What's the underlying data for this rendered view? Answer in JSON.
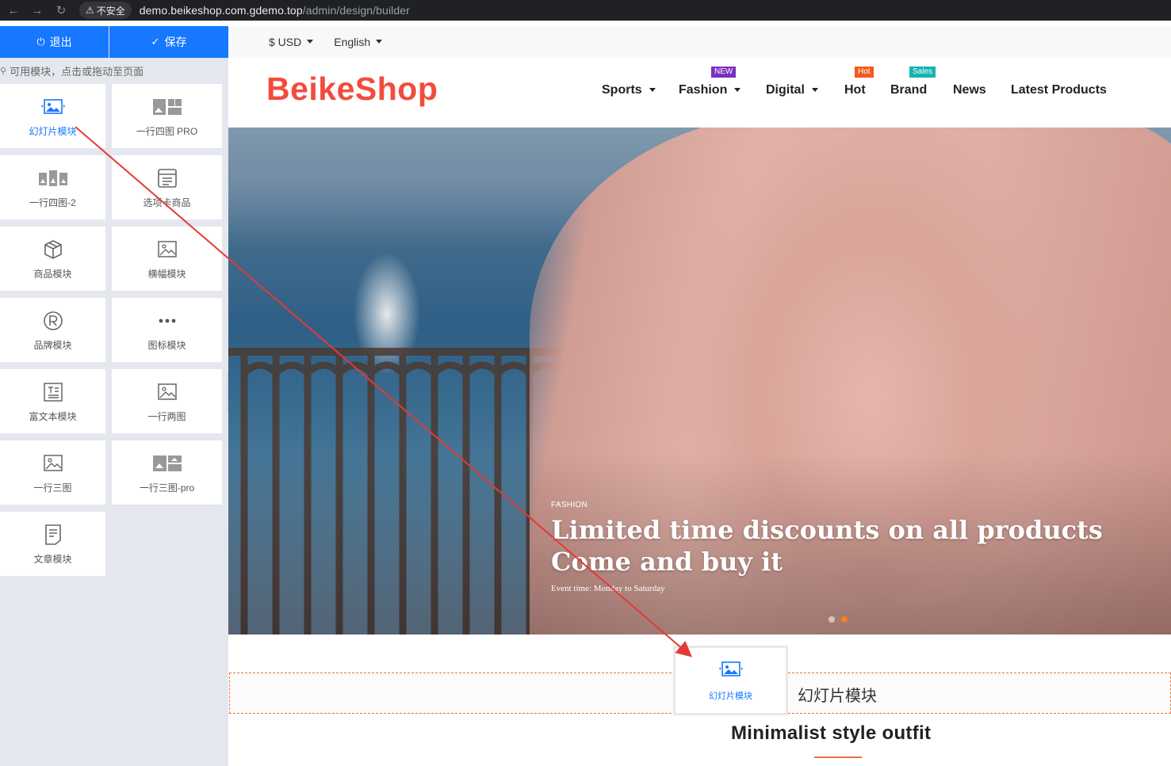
{
  "browser": {
    "security_label": "不安全",
    "url_host": "demo.beikeshop.com.gdemo.top",
    "url_path": "/admin/design/builder"
  },
  "panel": {
    "exit_label": "退出",
    "save_label": "保存",
    "hint": "可用模块，点击或拖动至页面",
    "modules": [
      {
        "label": "幻灯片模块",
        "icon": "image-slide-icon"
      },
      {
        "label": "一行四图 PRO",
        "icon": "four-images-pro-icon"
      },
      {
        "label": "一行四图-2",
        "icon": "four-images-icon"
      },
      {
        "label": "选项卡商品",
        "icon": "tab-products-icon"
      },
      {
        "label": "商品模块",
        "icon": "product-box-icon"
      },
      {
        "label": "横幅模块",
        "icon": "banner-image-icon"
      },
      {
        "label": "品牌模块",
        "icon": "registered-brand-icon"
      },
      {
        "label": "图标模块",
        "icon": "dots-icon"
      },
      {
        "label": "富文本模块",
        "icon": "rich-text-icon"
      },
      {
        "label": "一行两图",
        "icon": "two-images-icon"
      },
      {
        "label": "一行三图",
        "icon": "three-images-icon"
      },
      {
        "label": "一行三图-pro",
        "icon": "three-images-pro-icon"
      },
      {
        "label": "文章模块",
        "icon": "article-icon"
      }
    ]
  },
  "store": {
    "currency": "$ USD",
    "language": "English",
    "logo": "BeikeShop",
    "menu": [
      {
        "label": "Sports",
        "dropdown": true
      },
      {
        "label": "Fashion",
        "dropdown": true,
        "badge": "NEW",
        "badge_color": "#7b2fbe"
      },
      {
        "label": "Digital",
        "dropdown": true
      },
      {
        "label": "Hot",
        "dropdown": false,
        "badge": "Hot",
        "badge_color": "#f25a1f"
      },
      {
        "label": "Brand",
        "dropdown": false,
        "badge": "Sales",
        "badge_color": "#15b3b3"
      },
      {
        "label": "News",
        "dropdown": false
      },
      {
        "label": "Latest Products",
        "dropdown": false
      }
    ],
    "hero": {
      "tag": "FASHION",
      "title_line1": "Limited time discounts on all products",
      "title_line2": "Come and buy it",
      "subtitle": "Event time: Monday to Saturday",
      "active_slide": 2,
      "slide_count": 2
    },
    "drop_zone_label": "幻灯片模块",
    "dragging_module_label": "幻灯片模块",
    "section_title": "Minimalist style outfit"
  },
  "colors": {
    "primary": "#1677ff",
    "logo": "#f24c3c",
    "accent": "#e8703a",
    "arrow": "#e53935"
  }
}
